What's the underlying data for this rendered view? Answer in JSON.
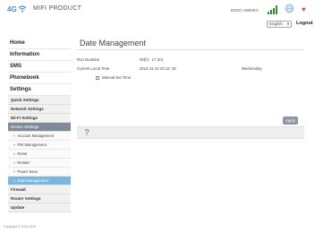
{
  "header": {
    "logo_4g": "4G",
    "brand": "MIFI PRODUCT",
    "carrier": "BSDD  HIBMEC",
    "language": "English",
    "logout": "Logout"
  },
  "sidebar": {
    "items": [
      {
        "label": "Home",
        "type": "main"
      },
      {
        "label": "Information",
        "type": "main"
      },
      {
        "label": "SMS",
        "type": "main"
      },
      {
        "label": "Phonebook",
        "type": "main"
      },
      {
        "label": "Settings",
        "type": "main"
      },
      {
        "label": "Quick Settings",
        "type": "small"
      },
      {
        "label": "Network Settings",
        "type": "small"
      },
      {
        "label": "Wi-Fi Settings",
        "type": "small"
      },
      {
        "label": "Device Settings",
        "type": "small-active"
      },
      {
        "label": "Account Management",
        "type": "sub"
      },
      {
        "label": "PIN Management",
        "type": "sub"
      },
      {
        "label": "Reset",
        "type": "sub"
      },
      {
        "label": "Restart",
        "type": "sub"
      },
      {
        "label": "Power Save",
        "type": "sub"
      },
      {
        "label": "Date Management",
        "type": "sub-active"
      },
      {
        "label": "Firewall",
        "type": "small"
      },
      {
        "label": "Router Settings",
        "type": "small"
      },
      {
        "label": "Update",
        "type": "small"
      }
    ]
  },
  "main": {
    "title": "Date Management",
    "run_duration_label": "Run Duration",
    "run_duration_value": "00(h) : 17 (m)",
    "local_time_label": "Current Local Time",
    "local_time_value": "2014-11-10 20:12: 25",
    "weekday": "Wednesday",
    "manual_label": "Manual Set Time",
    "manual_checked": false,
    "apply_label": "Apply",
    "help_icon": "question-mark"
  },
  "footer": {
    "copyright": "Copyright © 2013-2014"
  },
  "colors": {
    "active_section": "#7e8a98",
    "active_item": "#7bb7dd",
    "apply_button": "#8c97a2",
    "brand_blue": "#4b8fcc"
  }
}
